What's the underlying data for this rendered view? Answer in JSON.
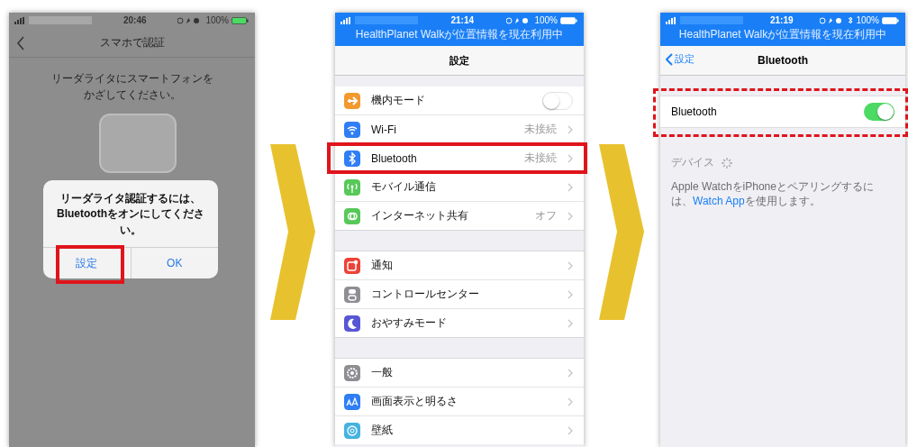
{
  "screens": [
    {
      "kind": "auth",
      "status": {
        "time": "20:46",
        "battery": "100%"
      },
      "nav": {
        "title": "スマホで認証"
      },
      "message_lines": [
        "リーダライタにスマートフォンを",
        "かざしてください。"
      ],
      "alert": {
        "message": "リーダライタ認証するには、Bluetoothをオンにしてください。",
        "buttons": [
          {
            "label": "設定",
            "highlighted": true
          },
          {
            "label": "OK",
            "highlighted": false
          }
        ]
      }
    },
    {
      "kind": "settings",
      "status": {
        "time": "21:14",
        "battery": "100%",
        "banner": "HealthPlanet Walkが位置情報を現在利用中"
      },
      "nav": {
        "title": "設定"
      },
      "sections": [
        [
          {
            "label": "機内モード",
            "kind": "toggle",
            "on": false,
            "highlighted": false,
            "color": "#f29a2e"
          },
          {
            "label": "Wi-Fi",
            "kind": "link",
            "detail": "未接続",
            "highlighted": false,
            "color": "#2f7ef5"
          },
          {
            "label": "Bluetooth",
            "kind": "link",
            "detail": "未接続",
            "highlighted": true,
            "color": "#2f7ef5"
          },
          {
            "label": "モバイル通信",
            "kind": "link",
            "highlighted": false,
            "color": "#58c85a"
          },
          {
            "label": "インターネット共有",
            "kind": "link",
            "detail": "オフ",
            "highlighted": false,
            "color": "#58c85a"
          }
        ],
        [
          {
            "label": "通知",
            "kind": "link",
            "highlighted": false,
            "color": "#ec4338"
          },
          {
            "label": "コントロールセンター",
            "kind": "link",
            "highlighted": false,
            "color": "#8e8e93"
          },
          {
            "label": "おやすみモード",
            "kind": "link",
            "highlighted": false,
            "color": "#5856d6"
          }
        ],
        [
          {
            "label": "一般",
            "kind": "link",
            "highlighted": false,
            "color": "#8e8e93"
          },
          {
            "label": "画面表示と明るさ",
            "kind": "link",
            "highlighted": false,
            "color": "#2f7ef5"
          },
          {
            "label": "壁紙",
            "kind": "link",
            "highlighted": false,
            "color": "#45b3e0"
          }
        ]
      ]
    },
    {
      "kind": "bluetooth",
      "status": {
        "time": "21:19",
        "battery": "100%",
        "bluetooth": true,
        "banner": "HealthPlanet Walkが位置情報を現在利用中"
      },
      "nav": {
        "back": "設定",
        "title": "Bluetooth"
      },
      "row": {
        "label": "Bluetooth",
        "on": true,
        "highlighted": true
      },
      "devices_label": "デバイス",
      "note": {
        "before": "Apple WatchをiPhoneとペアリングするには、",
        "link": "Watch App",
        "after": "を使用します。"
      }
    }
  ]
}
